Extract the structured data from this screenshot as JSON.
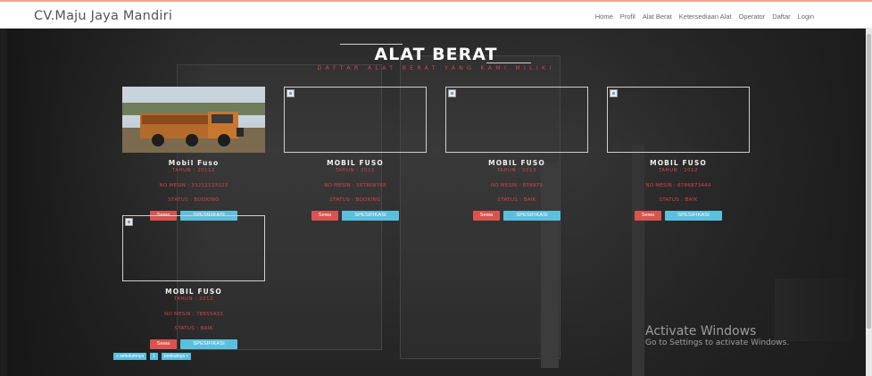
{
  "brand": "CV.Maju Jaya Mandiri",
  "nav": [
    "Home",
    "Profil",
    "Alat Berat",
    "Ketersediaan Alat",
    "Operator",
    "Daftar",
    "Login"
  ],
  "title": "ALAT BERAT",
  "subtitle": "DAFTAR ALAT BERAT YANG KAMI MILIKI",
  "cards": [
    {
      "name": "Mobil Fuso",
      "year": "TAHUN : 20112",
      "engine": "NO MESIN : 33211123123",
      "status": "STATUS : BOOKING",
      "rent": "Sewa",
      "spec": "SPESIFIKASI"
    },
    {
      "name": "MOBIL FUSO",
      "year": "TAHUN : 2011",
      "engine": "NO MESIN : 567868768",
      "status": "STATUS : BOOKING",
      "rent": "Sewa",
      "spec": "SPESIFIKASI"
    },
    {
      "name": "MOBIL FUSO",
      "year": "TAHUN : 2013",
      "engine": "NO MESIN : 878979",
      "status": "STATUS : BAIK",
      "rent": "Sewa",
      "spec": "SPESIFIKASI"
    },
    {
      "name": "MOBIL FUSO",
      "year": "TAHUN : 2012",
      "engine": "NO MESIN : 6786873444",
      "status": "STATUS : BAIK",
      "rent": "Sewa",
      "spec": "SPESIFIKASI"
    },
    {
      "name": "MOBIL FUSO",
      "year": "TAHUN : 2012",
      "engine": "NO MESIN : 78655433",
      "status": "STATUS : BAIK",
      "rent": "Sewa",
      "spec": "SPESIFIKASI"
    }
  ],
  "pagination": {
    "prev": "« sebelumnya",
    "page": "1",
    "next": "berikutnya »"
  },
  "watermark": {
    "title": "Activate Windows",
    "subtitle": "Go to Settings to activate Windows."
  },
  "colors": {
    "accent_red": "#d9414b",
    "btn_red": "#d9534f",
    "btn_blue": "#5bc0de",
    "navbar_bg": "#ffffff"
  }
}
